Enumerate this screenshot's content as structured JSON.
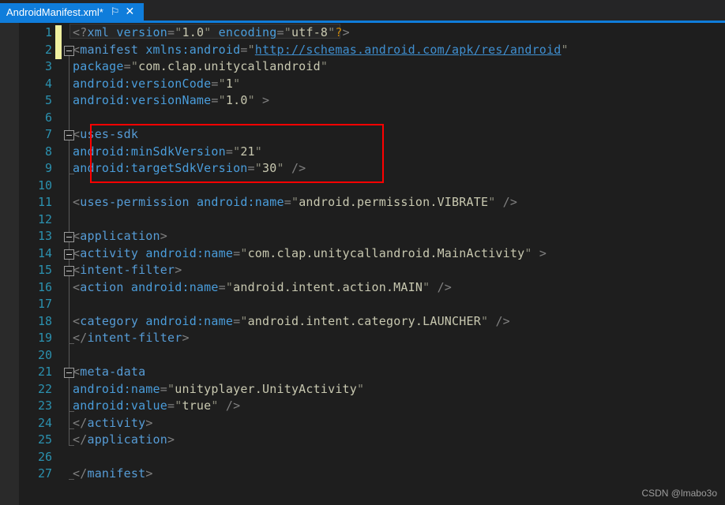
{
  "tab": {
    "title": "AndroidManifest.xml*",
    "pin_icon": "pin-icon",
    "close_icon": "close-icon",
    "pin_glyph": "⚐",
    "close_glyph": "✕",
    "active_color": "#0f7ddb"
  },
  "watermark": "CSDN @lmabo3o",
  "editor": {
    "language": "xml",
    "change_bar_color": "#f0f0a0",
    "annotation_color": "#ff0000",
    "line_numbers": [
      1,
      2,
      3,
      4,
      5,
      6,
      7,
      8,
      9,
      10,
      11,
      12,
      13,
      14,
      15,
      16,
      17,
      18,
      19,
      20,
      21,
      22,
      23,
      24,
      25,
      26,
      27
    ],
    "lines": [
      {
        "n": 1,
        "text": "<?xml version=\"1.0\" encoding=\"utf-8\"?>"
      },
      {
        "n": 2,
        "text": "<manifest xmlns:android=\"http://schemas.android.com/apk/res/android\""
      },
      {
        "n": 3,
        "text": "    package=\"com.clap.unitycallandroid\""
      },
      {
        "n": 4,
        "text": "    android:versionCode=\"1\""
      },
      {
        "n": 5,
        "text": "    android:versionName=\"1.0\" >"
      },
      {
        "n": 6,
        "text": ""
      },
      {
        "n": 7,
        "text": "    <uses-sdk"
      },
      {
        "n": 8,
        "text": "        android:minSdkVersion=\"21\""
      },
      {
        "n": 9,
        "text": "        android:targetSdkVersion=\"30\" />"
      },
      {
        "n": 10,
        "text": ""
      },
      {
        "n": 11,
        "text": "    <uses-permission android:name=\"android.permission.VIBRATE\" />"
      },
      {
        "n": 12,
        "text": ""
      },
      {
        "n": 13,
        "text": "    <application>"
      },
      {
        "n": 14,
        "text": "        <activity android:name=\"com.clap.unitycallandroid.MainActivity\" >"
      },
      {
        "n": 15,
        "text": "            <intent-filter>"
      },
      {
        "n": 16,
        "text": "                <action android:name=\"android.intent.action.MAIN\" />"
      },
      {
        "n": 17,
        "text": ""
      },
      {
        "n": 18,
        "text": "                <category android:name=\"android.intent.category.LAUNCHER\" />"
      },
      {
        "n": 19,
        "text": "            </intent-filter>"
      },
      {
        "n": 20,
        "text": ""
      },
      {
        "n": 21,
        "text": "            <meta-data"
      },
      {
        "n": 22,
        "text": "                android:name=\"unityplayer.UnityActivity\""
      },
      {
        "n": 23,
        "text": "                android:value=\"true\" />"
      },
      {
        "n": 24,
        "text": "        </activity>"
      },
      {
        "n": 25,
        "text": "    </application>"
      },
      {
        "n": 26,
        "text": ""
      },
      {
        "n": 27,
        "text": "</manifest>"
      }
    ],
    "fold_markers": [
      2,
      7,
      13,
      14,
      15,
      21
    ],
    "changed_lines": [
      1,
      2
    ],
    "annotated_lines": [
      7,
      8,
      9
    ],
    "url_value": "http://schemas.android.com/apk/res/android"
  }
}
